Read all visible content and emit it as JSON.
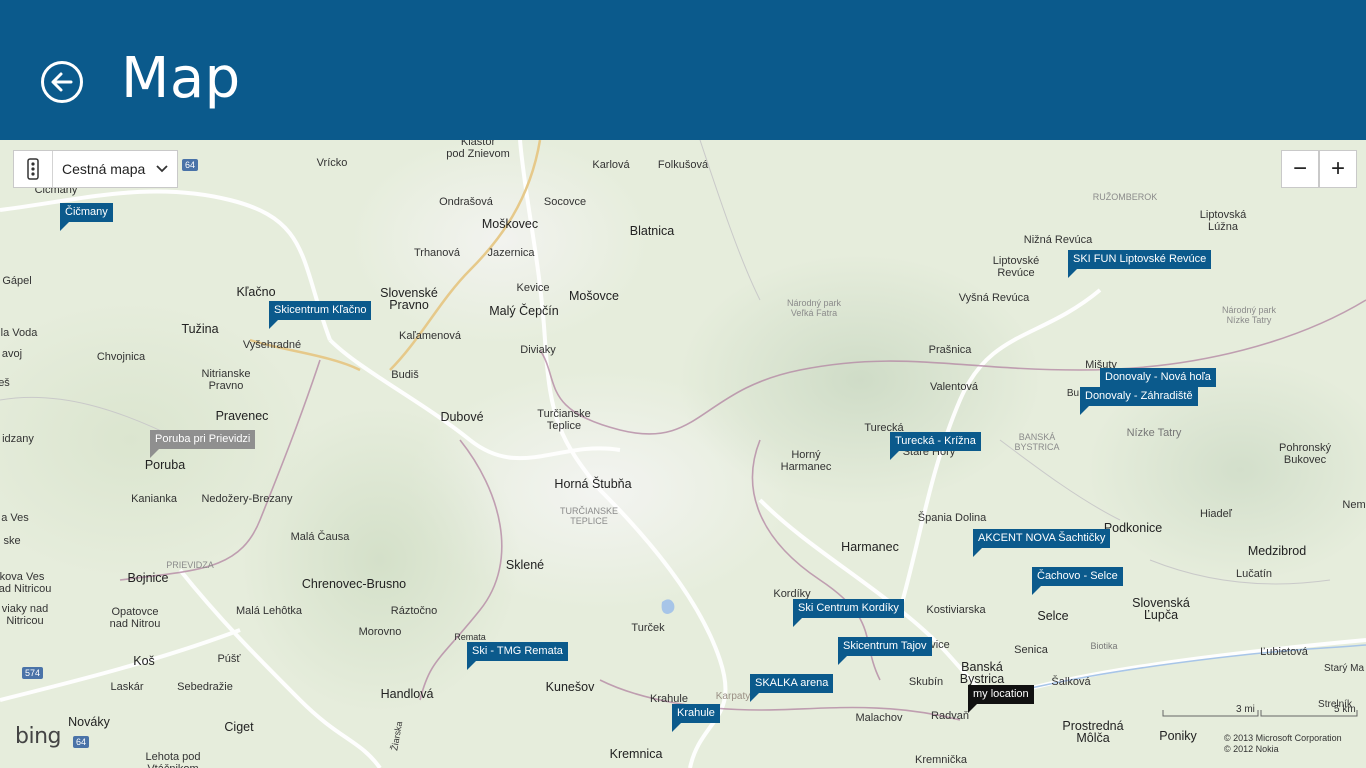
{
  "header": {
    "title": "Map"
  },
  "map_style": {
    "selected": "Cestná mapa"
  },
  "zoom": {
    "out_label": "−",
    "in_label": "+"
  },
  "pins": [
    {
      "label": "Čičmany",
      "style": "blue"
    },
    {
      "label": "Skicentrum Kľačno",
      "style": "blue"
    },
    {
      "label": "Poruba pri Prievidzi",
      "style": "gray"
    },
    {
      "label": "Ski - TMG Remata",
      "style": "blue"
    },
    {
      "label": "Krahule",
      "style": "blue"
    },
    {
      "label": "SKALKA arena",
      "style": "blue"
    },
    {
      "label": "Ski Centrum Kordíky",
      "style": "blue"
    },
    {
      "label": "Skicentrum Tajov",
      "style": "blue"
    },
    {
      "label": "my location",
      "style": "black"
    },
    {
      "label": "Turecká - Krížna",
      "style": "blue"
    },
    {
      "label": "AKCENT NOVA Šachtičky",
      "style": "blue"
    },
    {
      "label": "Čachovo - Selce",
      "style": "blue"
    },
    {
      "label": "SKI FUN Liptovské Revúce",
      "style": "blue"
    },
    {
      "label": "Donovaly - Nová hoľa",
      "style": "blue"
    },
    {
      "label": "Donovaly - Záhradiště",
      "style": "blue"
    }
  ],
  "towns": [
    "Vrícko",
    "Kláštor\npod Znievom",
    "Karlová",
    "Folkušová",
    "Čičmany",
    "Ondrašová",
    "Socovce",
    "Moškovec",
    "Blatnica",
    "Trhanová",
    "Jazernica",
    "Kevice",
    "Slovenské\nPravno",
    "Mošovce",
    "Malý Čepčín",
    "Kľačno",
    "Gápel",
    "Tužina",
    "Vyšehradné",
    "Kaľamenová",
    "Diviaky",
    "Budiš",
    "Chvojnica",
    "Nitrianske\nPravno",
    "Pravenec",
    "Dubové",
    "Turčianske\nTeplice",
    "Poruba",
    "Kanianka",
    "Nedožery-Brezany",
    "Horná Štubňa",
    "Malá Čausa",
    "Bojnice",
    "Chrenovec-Brusno",
    "Sklené",
    "Opatovce\nnad Nitrou",
    "Malá Lehôtka",
    "Ráztočno",
    "Morovno",
    "Remata",
    "Turček",
    "Koš",
    "Púšť",
    "Laskár",
    "Sebedražie",
    "Handlová",
    "Kunešov",
    "Krahule",
    "Karpaty",
    "Nováky",
    "Ciget",
    "Lehota pod\nVtáčnikom",
    "Kremnica",
    "Žiarska",
    "Kordíky",
    "Horný\nHarmanec",
    "Turecká",
    "Staré Hory",
    "Harmanec",
    "Špania Dolina",
    "Kostiviarska",
    "Selce",
    "Senica",
    "Banská\nBystrica",
    "Skubín",
    "Malachov",
    "Radvaň",
    "Kremnička",
    "Šalková",
    "Podkonice",
    "Slovenská\nĽupča",
    "Medzibrod",
    "Lučatín",
    "Hiadeľ",
    "Pohronský\nBukovec",
    "Nízke Tatry",
    "Prostredná\nMôlča",
    "Poniky",
    "Ľubietová",
    "Starý Ma",
    "Strelník",
    "Nem",
    "Liptovská\nLúžna",
    "Nižná Revúca",
    "Liptovské\nRevúce",
    "Vyšná Revúca",
    "Prašnica",
    "Valentová",
    "Mišuty",
    "Bu",
    "Biotika",
    "vice",
    "la Voda",
    "avoj",
    "eš",
    "idzany",
    "a Ves",
    "ske",
    "kova Ves\nnad Nitricou",
    "viaky nad\nNitricou"
  ],
  "regions": [
    "Národný park\nVeľká Fatra",
    "RUŽOMBEROK",
    "Národný park\nNízke Tatry",
    "BANSKÁ\nBYSTRICA",
    "TURČIANSKE\nTEPLICE",
    "PRIEVIDZA"
  ],
  "road_shields": [
    "64",
    "574",
    "64"
  ],
  "scale": {
    "left": "3 mi",
    "right": "5 km"
  },
  "branding": {
    "logo": "bing"
  },
  "copyright": {
    "line1": "© 2013 Microsoft Corporation",
    "line2": "© 2012 Nokia"
  }
}
